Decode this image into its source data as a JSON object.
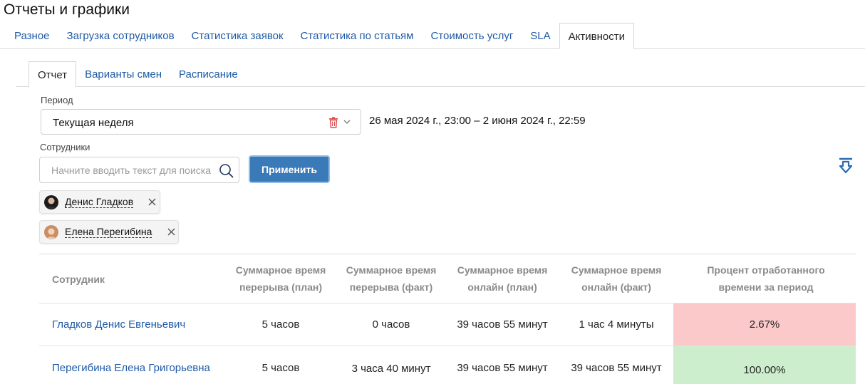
{
  "page_title": "Отчеты и графики",
  "top_tabs": [
    {
      "label": "Разное",
      "active": false
    },
    {
      "label": "Загрузка сотрудников",
      "active": false
    },
    {
      "label": "Статистика заявок",
      "active": false
    },
    {
      "label": "Статистика по статьям",
      "active": false
    },
    {
      "label": "Стоимость услуг",
      "active": false
    },
    {
      "label": "SLA",
      "active": false
    },
    {
      "label": "Активности",
      "active": true
    }
  ],
  "sub_tabs": [
    {
      "label": "Отчет",
      "active": true
    },
    {
      "label": "Варианты смен",
      "active": false
    },
    {
      "label": "Расписание",
      "active": false
    }
  ],
  "filters": {
    "period_label": "Период",
    "period_value": "Текущая неделя",
    "date_range": "26 мая 2024 г., 23:00  –  2 июня 2024 г., 22:59",
    "employees_label": "Сотрудники",
    "search_placeholder": "Начните вводить текст для поиска",
    "apply_label": "Применить"
  },
  "selected_employees": [
    {
      "name": "Денис Гладков"
    },
    {
      "name": "Елена Перегибина"
    }
  ],
  "table": {
    "headers": {
      "employee": "Сотрудник",
      "break_plan": "Суммарное время перерыва (план)",
      "break_fact": "Суммарное время перерыва (факт)",
      "online_plan": "Суммарное время онлайн (план)",
      "online_fact": "Суммарное время онлайн (факт)",
      "percent": "Процент отработанного времени за период"
    },
    "rows": [
      {
        "employee": "Гладков Денис Евгеньевич",
        "break_plan": "5 часов",
        "break_fact": "0 часов",
        "online_plan": "39 часов 55 минут",
        "online_fact": "1 час 4 минуты",
        "percent": "2.67%"
      },
      {
        "employee": "Перегибина Елена Григорьевна",
        "break_plan": "5 часов",
        "break_fact": "3 часа 40 минут",
        "online_plan": "39 часов 55 минут",
        "online_fact": "39 часов 55 минут",
        "percent": "100.00%"
      }
    ]
  },
  "colors": {
    "link": "#1e5aa6",
    "primary_button": "#3a7ab8",
    "percent_low_bg": "#fbc9c9",
    "percent_high_bg": "#cdeecd",
    "delete_icon": "#e05050"
  }
}
